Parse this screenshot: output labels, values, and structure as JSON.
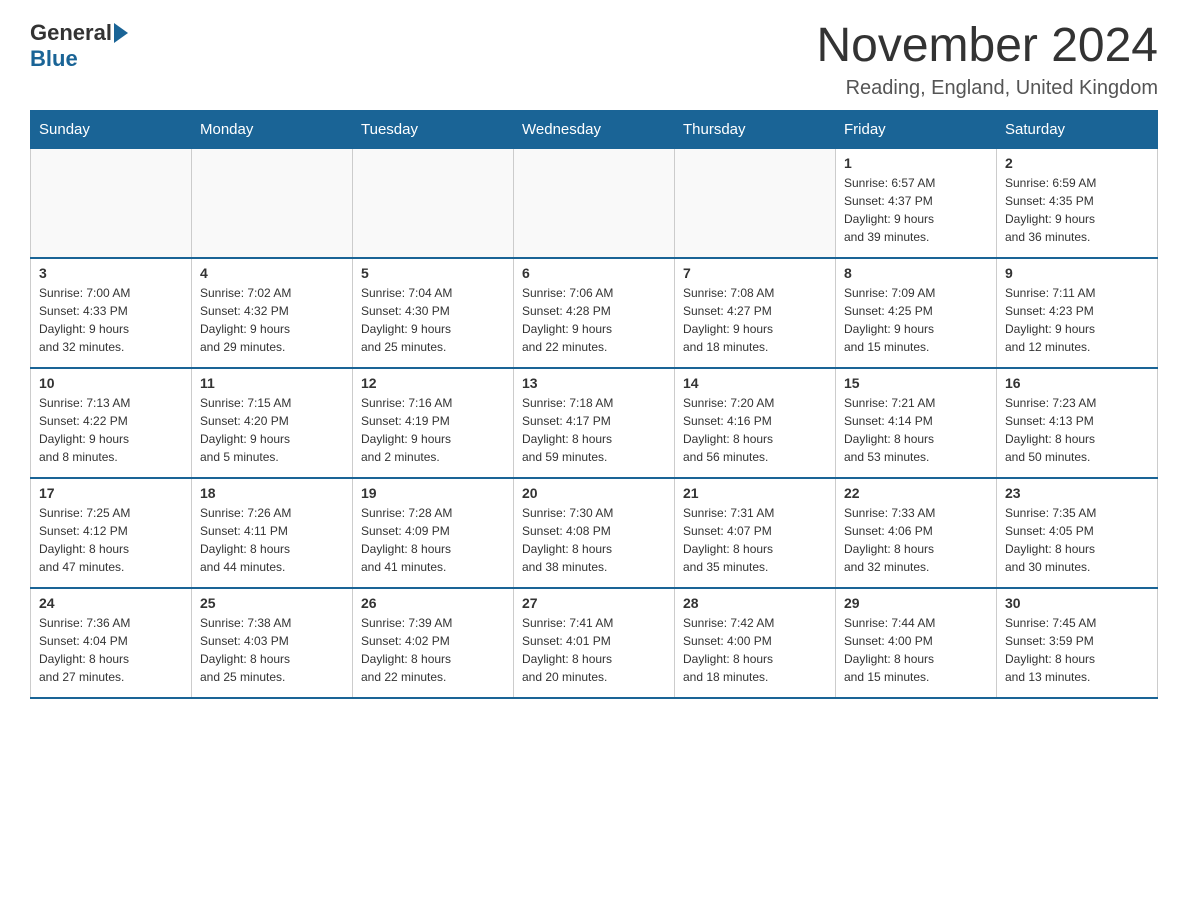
{
  "header": {
    "logo_general": "General",
    "logo_blue": "Blue",
    "month_title": "November 2024",
    "location": "Reading, England, United Kingdom"
  },
  "days_of_week": [
    "Sunday",
    "Monday",
    "Tuesday",
    "Wednesday",
    "Thursday",
    "Friday",
    "Saturday"
  ],
  "weeks": [
    [
      {
        "day": "",
        "info": ""
      },
      {
        "day": "",
        "info": ""
      },
      {
        "day": "",
        "info": ""
      },
      {
        "day": "",
        "info": ""
      },
      {
        "day": "",
        "info": ""
      },
      {
        "day": "1",
        "info": "Sunrise: 6:57 AM\nSunset: 4:37 PM\nDaylight: 9 hours\nand 39 minutes."
      },
      {
        "day": "2",
        "info": "Sunrise: 6:59 AM\nSunset: 4:35 PM\nDaylight: 9 hours\nand 36 minutes."
      }
    ],
    [
      {
        "day": "3",
        "info": "Sunrise: 7:00 AM\nSunset: 4:33 PM\nDaylight: 9 hours\nand 32 minutes."
      },
      {
        "day": "4",
        "info": "Sunrise: 7:02 AM\nSunset: 4:32 PM\nDaylight: 9 hours\nand 29 minutes."
      },
      {
        "day": "5",
        "info": "Sunrise: 7:04 AM\nSunset: 4:30 PM\nDaylight: 9 hours\nand 25 minutes."
      },
      {
        "day": "6",
        "info": "Sunrise: 7:06 AM\nSunset: 4:28 PM\nDaylight: 9 hours\nand 22 minutes."
      },
      {
        "day": "7",
        "info": "Sunrise: 7:08 AM\nSunset: 4:27 PM\nDaylight: 9 hours\nand 18 minutes."
      },
      {
        "day": "8",
        "info": "Sunrise: 7:09 AM\nSunset: 4:25 PM\nDaylight: 9 hours\nand 15 minutes."
      },
      {
        "day": "9",
        "info": "Sunrise: 7:11 AM\nSunset: 4:23 PM\nDaylight: 9 hours\nand 12 minutes."
      }
    ],
    [
      {
        "day": "10",
        "info": "Sunrise: 7:13 AM\nSunset: 4:22 PM\nDaylight: 9 hours\nand 8 minutes."
      },
      {
        "day": "11",
        "info": "Sunrise: 7:15 AM\nSunset: 4:20 PM\nDaylight: 9 hours\nand 5 minutes."
      },
      {
        "day": "12",
        "info": "Sunrise: 7:16 AM\nSunset: 4:19 PM\nDaylight: 9 hours\nand 2 minutes."
      },
      {
        "day": "13",
        "info": "Sunrise: 7:18 AM\nSunset: 4:17 PM\nDaylight: 8 hours\nand 59 minutes."
      },
      {
        "day": "14",
        "info": "Sunrise: 7:20 AM\nSunset: 4:16 PM\nDaylight: 8 hours\nand 56 minutes."
      },
      {
        "day": "15",
        "info": "Sunrise: 7:21 AM\nSunset: 4:14 PM\nDaylight: 8 hours\nand 53 minutes."
      },
      {
        "day": "16",
        "info": "Sunrise: 7:23 AM\nSunset: 4:13 PM\nDaylight: 8 hours\nand 50 minutes."
      }
    ],
    [
      {
        "day": "17",
        "info": "Sunrise: 7:25 AM\nSunset: 4:12 PM\nDaylight: 8 hours\nand 47 minutes."
      },
      {
        "day": "18",
        "info": "Sunrise: 7:26 AM\nSunset: 4:11 PM\nDaylight: 8 hours\nand 44 minutes."
      },
      {
        "day": "19",
        "info": "Sunrise: 7:28 AM\nSunset: 4:09 PM\nDaylight: 8 hours\nand 41 minutes."
      },
      {
        "day": "20",
        "info": "Sunrise: 7:30 AM\nSunset: 4:08 PM\nDaylight: 8 hours\nand 38 minutes."
      },
      {
        "day": "21",
        "info": "Sunrise: 7:31 AM\nSunset: 4:07 PM\nDaylight: 8 hours\nand 35 minutes."
      },
      {
        "day": "22",
        "info": "Sunrise: 7:33 AM\nSunset: 4:06 PM\nDaylight: 8 hours\nand 32 minutes."
      },
      {
        "day": "23",
        "info": "Sunrise: 7:35 AM\nSunset: 4:05 PM\nDaylight: 8 hours\nand 30 minutes."
      }
    ],
    [
      {
        "day": "24",
        "info": "Sunrise: 7:36 AM\nSunset: 4:04 PM\nDaylight: 8 hours\nand 27 minutes."
      },
      {
        "day": "25",
        "info": "Sunrise: 7:38 AM\nSunset: 4:03 PM\nDaylight: 8 hours\nand 25 minutes."
      },
      {
        "day": "26",
        "info": "Sunrise: 7:39 AM\nSunset: 4:02 PM\nDaylight: 8 hours\nand 22 minutes."
      },
      {
        "day": "27",
        "info": "Sunrise: 7:41 AM\nSunset: 4:01 PM\nDaylight: 8 hours\nand 20 minutes."
      },
      {
        "day": "28",
        "info": "Sunrise: 7:42 AM\nSunset: 4:00 PM\nDaylight: 8 hours\nand 18 minutes."
      },
      {
        "day": "29",
        "info": "Sunrise: 7:44 AM\nSunset: 4:00 PM\nDaylight: 8 hours\nand 15 minutes."
      },
      {
        "day": "30",
        "info": "Sunrise: 7:45 AM\nSunset: 3:59 PM\nDaylight: 8 hours\nand 13 minutes."
      }
    ]
  ]
}
